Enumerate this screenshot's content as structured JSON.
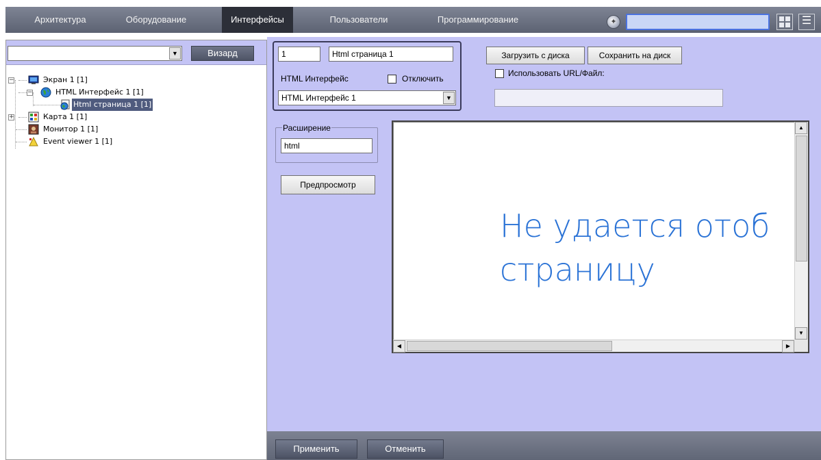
{
  "tabs": [
    {
      "label": "Архитектура",
      "active": false
    },
    {
      "label": "Оборудование",
      "active": false
    },
    {
      "label": "Интерфейсы",
      "active": true
    },
    {
      "label": "Пользователи",
      "active": false
    },
    {
      "label": "Программирование",
      "active": false
    }
  ],
  "left": {
    "combo_value": "",
    "wizard_label": "Визард",
    "tree": [
      {
        "label": "Экран 1 [1]",
        "icon": "monitor-screen-icon",
        "expander": "minus"
      },
      {
        "label": "HTML Интерфейс 1 [1]",
        "icon": "globe-icon",
        "expander": "minus"
      },
      {
        "label": "Html страница 1 [1]",
        "icon": "html-page-icon",
        "selected": true
      },
      {
        "label": "Карта 1 [1]",
        "icon": "map-icon",
        "expander": "plus"
      },
      {
        "label": "Монитор 1 [1]",
        "icon": "camera-monitor-icon"
      },
      {
        "label": "Event viewer 1 [1]",
        "icon": "event-viewer-icon"
      }
    ]
  },
  "form": {
    "id_value": "1",
    "name_value": "Html страница 1",
    "interface_label": "HTML Интерфейс",
    "disable_label": "Отключить",
    "disable_checked": false,
    "interface_select": "HTML Интерфейс 1",
    "load_label": "Загрузить с диска",
    "save_label": "Сохранить на диск",
    "use_url_label": "Использовать URL/Файл:",
    "use_url_checked": false,
    "url_value": "",
    "ext_legend": "Расширение",
    "ext_value": "html",
    "preview_label": "Предпросмотр",
    "preview_line1": "Не удается отоб",
    "preview_line2": "страницу"
  },
  "bottom": {
    "apply_label": "Применить",
    "cancel_label": "Отменить"
  },
  "colors": {
    "panel_bg": "#c3c3f5",
    "preview_text": "#2b73d6",
    "tab_active": "#2c2f38",
    "selection": "#4f5b7e"
  }
}
